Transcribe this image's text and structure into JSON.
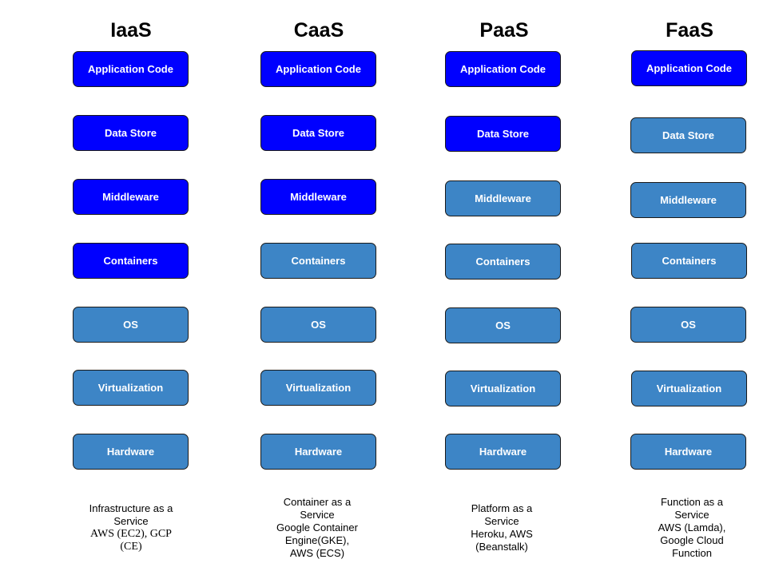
{
  "colors": {
    "user_managed": "#0000ff",
    "provider_managed": "#3d85c6",
    "border": "#1a1a1a"
  },
  "columns": [
    {
      "title": "IaaS",
      "layers": [
        {
          "label": "Application Code",
          "managed": "user"
        },
        {
          "label": "Data Store",
          "managed": "user"
        },
        {
          "label": "Middleware",
          "managed": "user"
        },
        {
          "label": "Containers",
          "managed": "user"
        },
        {
          "label": "OS",
          "managed": "provider"
        },
        {
          "label": "Virtualization",
          "managed": "provider"
        },
        {
          "label": "Hardware",
          "managed": "provider"
        }
      ],
      "caption_lines": [
        "Infrastructure as a",
        "Service"
      ],
      "caption_examples": [
        "AWS (EC2), GCP",
        "(CE)"
      ]
    },
    {
      "title": "CaaS",
      "layers": [
        {
          "label": "Application Code",
          "managed": "user"
        },
        {
          "label": "Data Store",
          "managed": "user"
        },
        {
          "label": "Middleware",
          "managed": "user"
        },
        {
          "label": "Containers",
          "managed": "provider"
        },
        {
          "label": "OS",
          "managed": "provider"
        },
        {
          "label": "Virtualization",
          "managed": "provider"
        },
        {
          "label": "Hardware",
          "managed": "provider"
        }
      ],
      "caption_lines": [
        "Container as a",
        "Service"
      ],
      "caption_examples": [
        "Google Container",
        "Engine(GKE),",
        "AWS (ECS)"
      ]
    },
    {
      "title": "PaaS",
      "layers": [
        {
          "label": "Application Code",
          "managed": "user"
        },
        {
          "label": "Data Store",
          "managed": "user"
        },
        {
          "label": "Middleware",
          "managed": "provider"
        },
        {
          "label": "Containers",
          "managed": "provider"
        },
        {
          "label": "OS",
          "managed": "provider"
        },
        {
          "label": "Virtualization",
          "managed": "provider"
        },
        {
          "label": "Hardware",
          "managed": "provider"
        }
      ],
      "caption_lines": [
        "Platform as a",
        "Service"
      ],
      "caption_examples": [
        "Heroku, AWS",
        "(Beanstalk)"
      ]
    },
    {
      "title": "FaaS",
      "layers": [
        {
          "label": "Application Code",
          "managed": "user"
        },
        {
          "label": "Data Store",
          "managed": "provider"
        },
        {
          "label": "Middleware",
          "managed": "provider"
        },
        {
          "label": "Containers",
          "managed": "provider"
        },
        {
          "label": "OS",
          "managed": "provider"
        },
        {
          "label": "Virtualization",
          "managed": "provider"
        },
        {
          "label": "Hardware",
          "managed": "provider"
        }
      ],
      "caption_lines": [
        "Function as a",
        "Service"
      ],
      "caption_examples": [
        "AWS (Lamda),",
        "Google Cloud",
        "Function"
      ]
    }
  ]
}
